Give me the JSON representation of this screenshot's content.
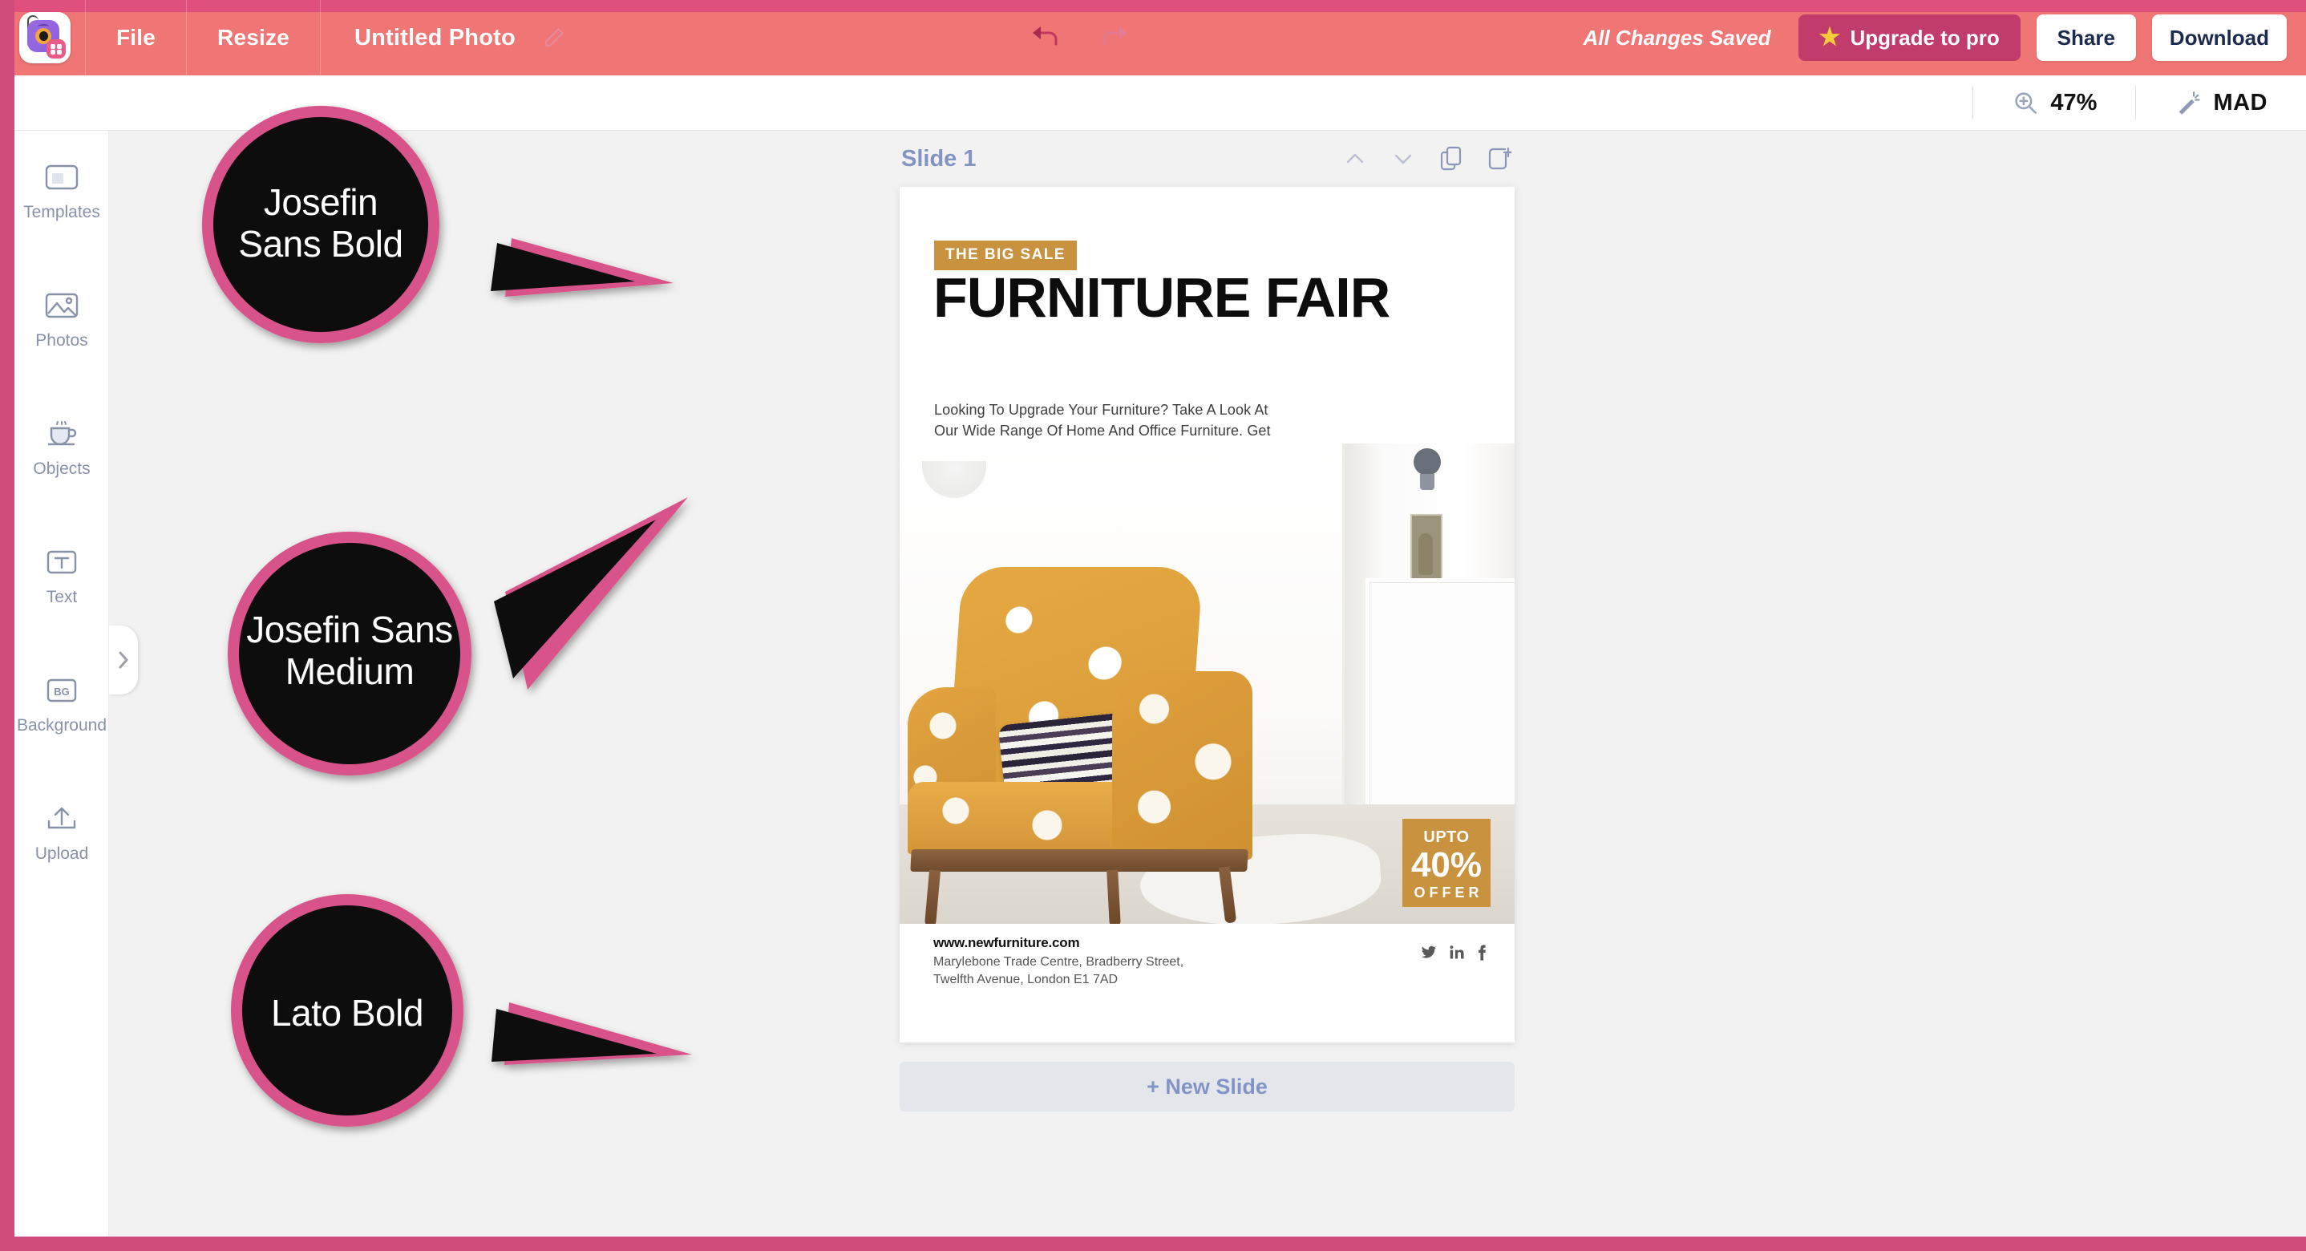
{
  "app": {
    "logo_name": "photo-editor-logo",
    "menu": [
      "File",
      "Resize"
    ],
    "doc_title": "Untitled Photo",
    "saved_status": "All Changes Saved",
    "upgrade_label": "Upgrade to pro",
    "share_label": "Share",
    "download_label": "Download"
  },
  "subbar": {
    "zoom_level": "47%",
    "mad_label": "MAD"
  },
  "sidebar": {
    "items": [
      {
        "label": "Templates",
        "icon": "templates-icon"
      },
      {
        "label": "Photos",
        "icon": "photos-icon"
      },
      {
        "label": "Objects",
        "icon": "objects-icon"
      },
      {
        "label": "Text",
        "icon": "text-icon"
      },
      {
        "label": "Background",
        "icon": "background-icon"
      },
      {
        "label": "Upload",
        "icon": "upload-icon"
      }
    ]
  },
  "canvas": {
    "slide_label": "Slide 1",
    "new_slide_label": "+ New Slide"
  },
  "poster": {
    "badge": "THE BIG SALE",
    "headline": "FURNITURE FAIR",
    "body": "Looking To Upgrade Your Furniture? Take A Look At Our Wide Range Of Home And Office Furniture. Get Them At Prices You've Never Imagined Before.",
    "offer": {
      "upto": "UPTO",
      "percent": "40%",
      "label": "OFFER"
    },
    "footer": {
      "website": "www.newfurniture.com",
      "address": "Marylebone Trade Centre, Bradberry Street, Twelfth Avenue, London E1 7AD",
      "social": [
        "twitter",
        "linkedin",
        "facebook"
      ]
    },
    "accent_color": "#c9923f"
  },
  "callouts": [
    {
      "line1": "Josefin",
      "line2": "Sans Bold"
    },
    {
      "line1": "Josefin Sans",
      "line2": "Medium"
    },
    {
      "line1": "Lato Bold",
      "line2": ""
    }
  ],
  "colors": {
    "frame_pink": "#cf4b7c",
    "topbar_pink": "#f07575",
    "topbar_strip": "#e0507e",
    "upgrade_bg": "#c23c6b",
    "bubble_border": "#d8538a",
    "sidebar_text": "#8791a8",
    "slide_label": "#8294c4",
    "poster_gold": "#c9923f"
  }
}
